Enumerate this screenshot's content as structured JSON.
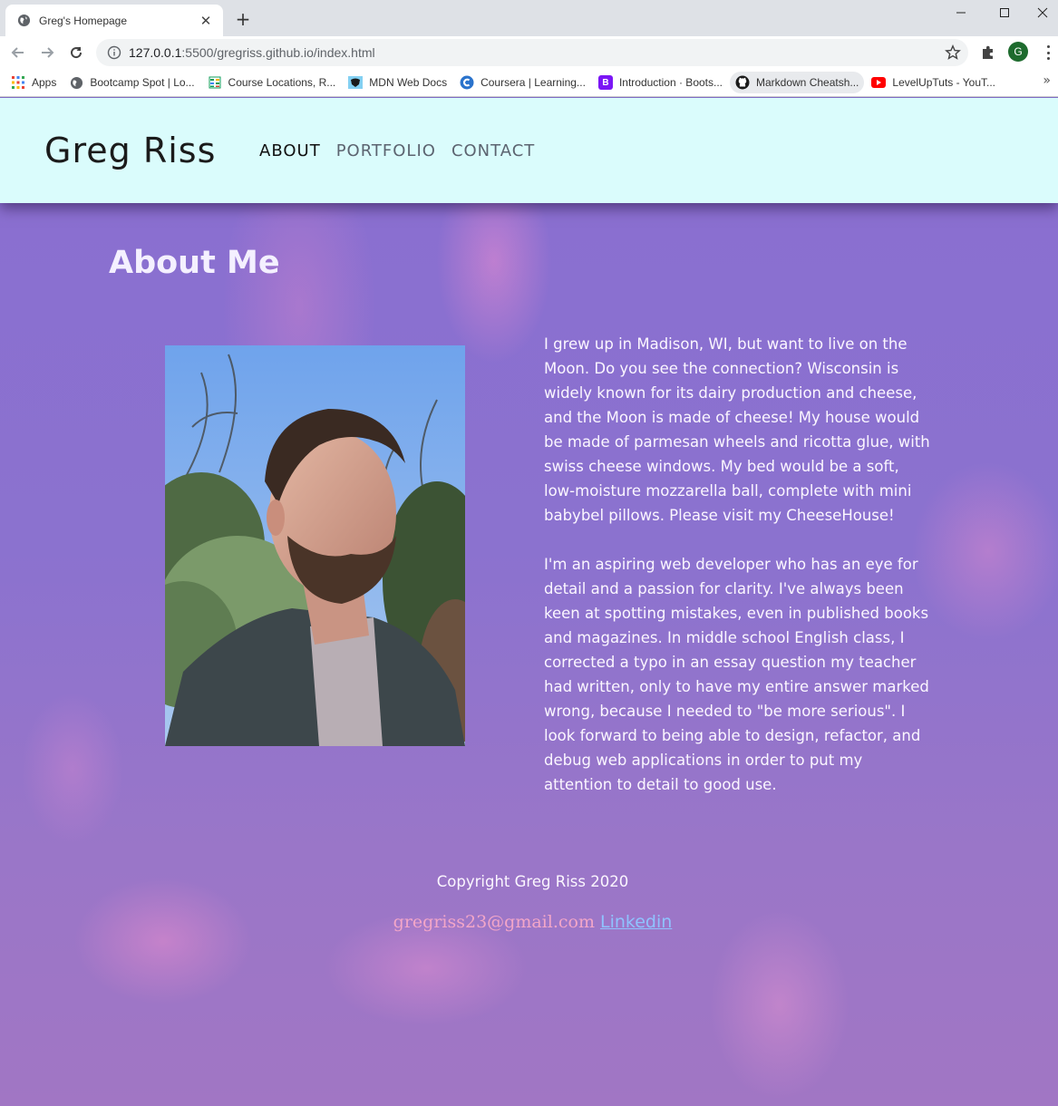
{
  "browser": {
    "tab_title": "Greg's Homepage",
    "tab_close": "✕",
    "new_tab": "+",
    "url_host": "127.0.0.1",
    "url_rest": ":5500/gregriss.github.io/index.html",
    "profile_initial": "G",
    "bookmarks": [
      {
        "label": "Apps",
        "icon": "apps-grid-icon",
        "color": "#ea4335"
      },
      {
        "label": "Bootcamp Spot | Lo...",
        "icon": "globe-icon",
        "color": "#555555"
      },
      {
        "label": "Course Locations, R...",
        "icon": "sheets-icon",
        "color": "#0f9d58"
      },
      {
        "label": "MDN Web Docs",
        "icon": "mdn-icon",
        "color": "#1a1a1a"
      },
      {
        "label": "Coursera | Learning...",
        "icon": "coursera-icon",
        "color": "#2a73cc"
      },
      {
        "label": "Introduction · Boots...",
        "icon": "bootstrap-icon",
        "color": "#7b16f5"
      },
      {
        "label": "Markdown Cheatsh...",
        "icon": "github-icon",
        "color": "#1a1a1a"
      },
      {
        "label": "LevelUpTuts - YouT...",
        "icon": "youtube-icon",
        "color": "#ff0000"
      }
    ],
    "bookmarks_more": "»"
  },
  "site": {
    "brand": "Greg Riss",
    "nav": [
      {
        "label": "ABOUT",
        "active": true
      },
      {
        "label": "PORTFOLIO",
        "active": false
      },
      {
        "label": "CONTACT",
        "active": false
      }
    ],
    "about_title": "About Me",
    "bio_p1": "I grew up in Madison, WI, but want to live on the Moon. Do you see the connection? Wisconsin is widely known for its dairy production and cheese, and the Moon is made of cheese! My house would be made of parmesan wheels and ricotta glue, with swiss cheese windows. My bed would be a soft, low-moisture mozzarella ball, complete with mini babybel pillows. Please visit my CheeseHouse!",
    "bio_p2": "I'm an aspiring web developer who has an eye for detail and a passion for clarity. I've always been keen at spotting mistakes, even in published books and magazines. In middle school English class, I corrected a typo in an essay question my teacher had written, only to have my entire answer marked wrong, because I needed to \"be more serious\". I look forward to being able to design, refactor, and debug web applications in order to put my attention to detail to good use.",
    "copyright": "Copyright Greg Riss 2020",
    "email": "gregriss23@gmail.com",
    "linkedin": "Linkedin",
    "header_bg": "#dafcfc",
    "email_color": "#f3a6c8",
    "link_color": "#8fc3ff"
  }
}
